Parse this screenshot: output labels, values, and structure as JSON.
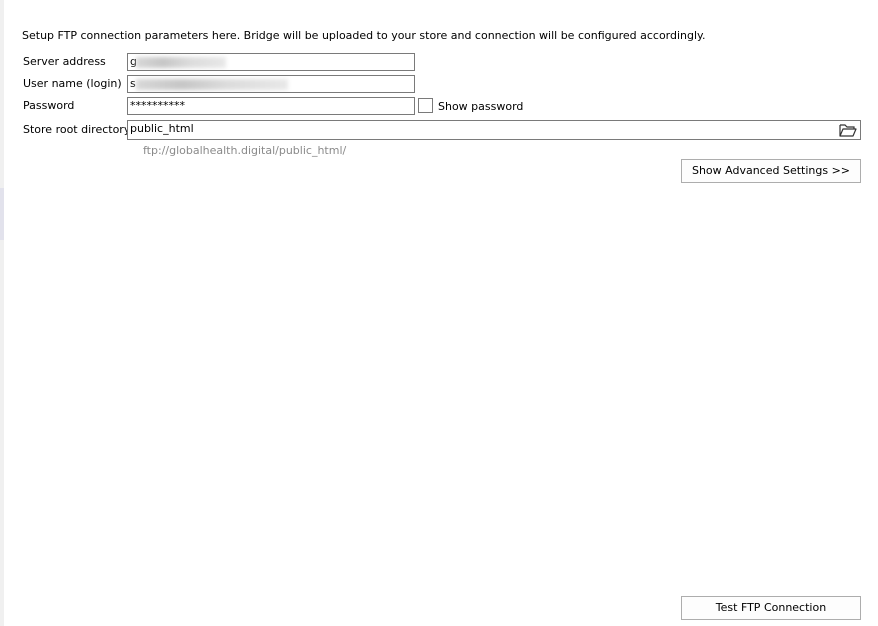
{
  "intro_text": "Setup FTP connection parameters here. Bridge will be uploaded to your store and connection will be configured accordingly.",
  "server": {
    "label": "Server address",
    "value": "g"
  },
  "username": {
    "label": "User name (login)",
    "value": "s"
  },
  "password": {
    "label": "Password",
    "value": "**********"
  },
  "show_password": {
    "label": "Show password",
    "checked": false
  },
  "root_dir": {
    "label": "Store root directory",
    "value": "public_html",
    "browse_icon": "folder-open-icon"
  },
  "hint_url": "ftp://globalhealth.digital/public_html/",
  "advanced_button": "Show Advanced Settings >>",
  "test_button": "Test FTP Connection"
}
